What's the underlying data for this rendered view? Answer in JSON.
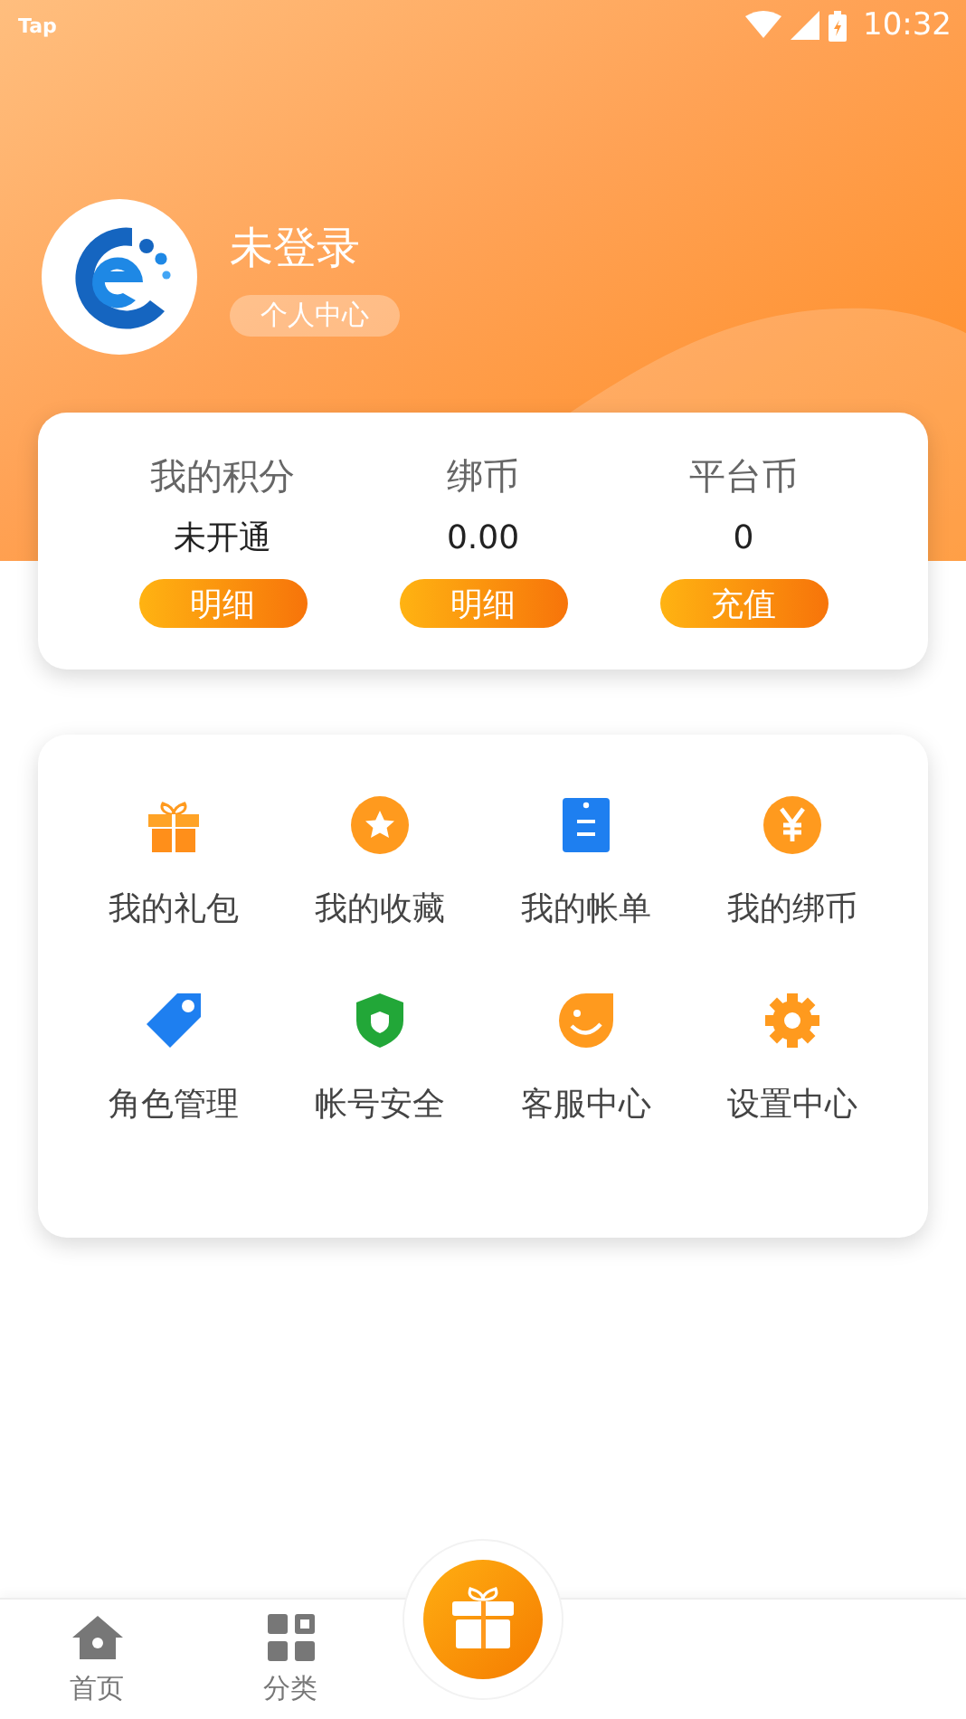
{
  "status_bar": {
    "carrier": "Tap",
    "time": "10:32"
  },
  "profile": {
    "name": "未登录",
    "link": "个人中心"
  },
  "balances": [
    {
      "label": "我的积分",
      "value": "未开通",
      "action": "明细"
    },
    {
      "label": "绑币",
      "value": "0.00",
      "action": "明细"
    },
    {
      "label": "平台币",
      "value": "0",
      "action": "充值"
    }
  ],
  "menu": [
    {
      "label": "我的礼包"
    },
    {
      "label": "我的收藏"
    },
    {
      "label": "我的帐单"
    },
    {
      "label": "我的绑币"
    },
    {
      "label": "角色管理"
    },
    {
      "label": "帐号安全"
    },
    {
      "label": "客服中心"
    },
    {
      "label": "设置中心"
    }
  ],
  "bottom_nav": [
    {
      "label": "首页"
    },
    {
      "label": "分类"
    }
  ]
}
